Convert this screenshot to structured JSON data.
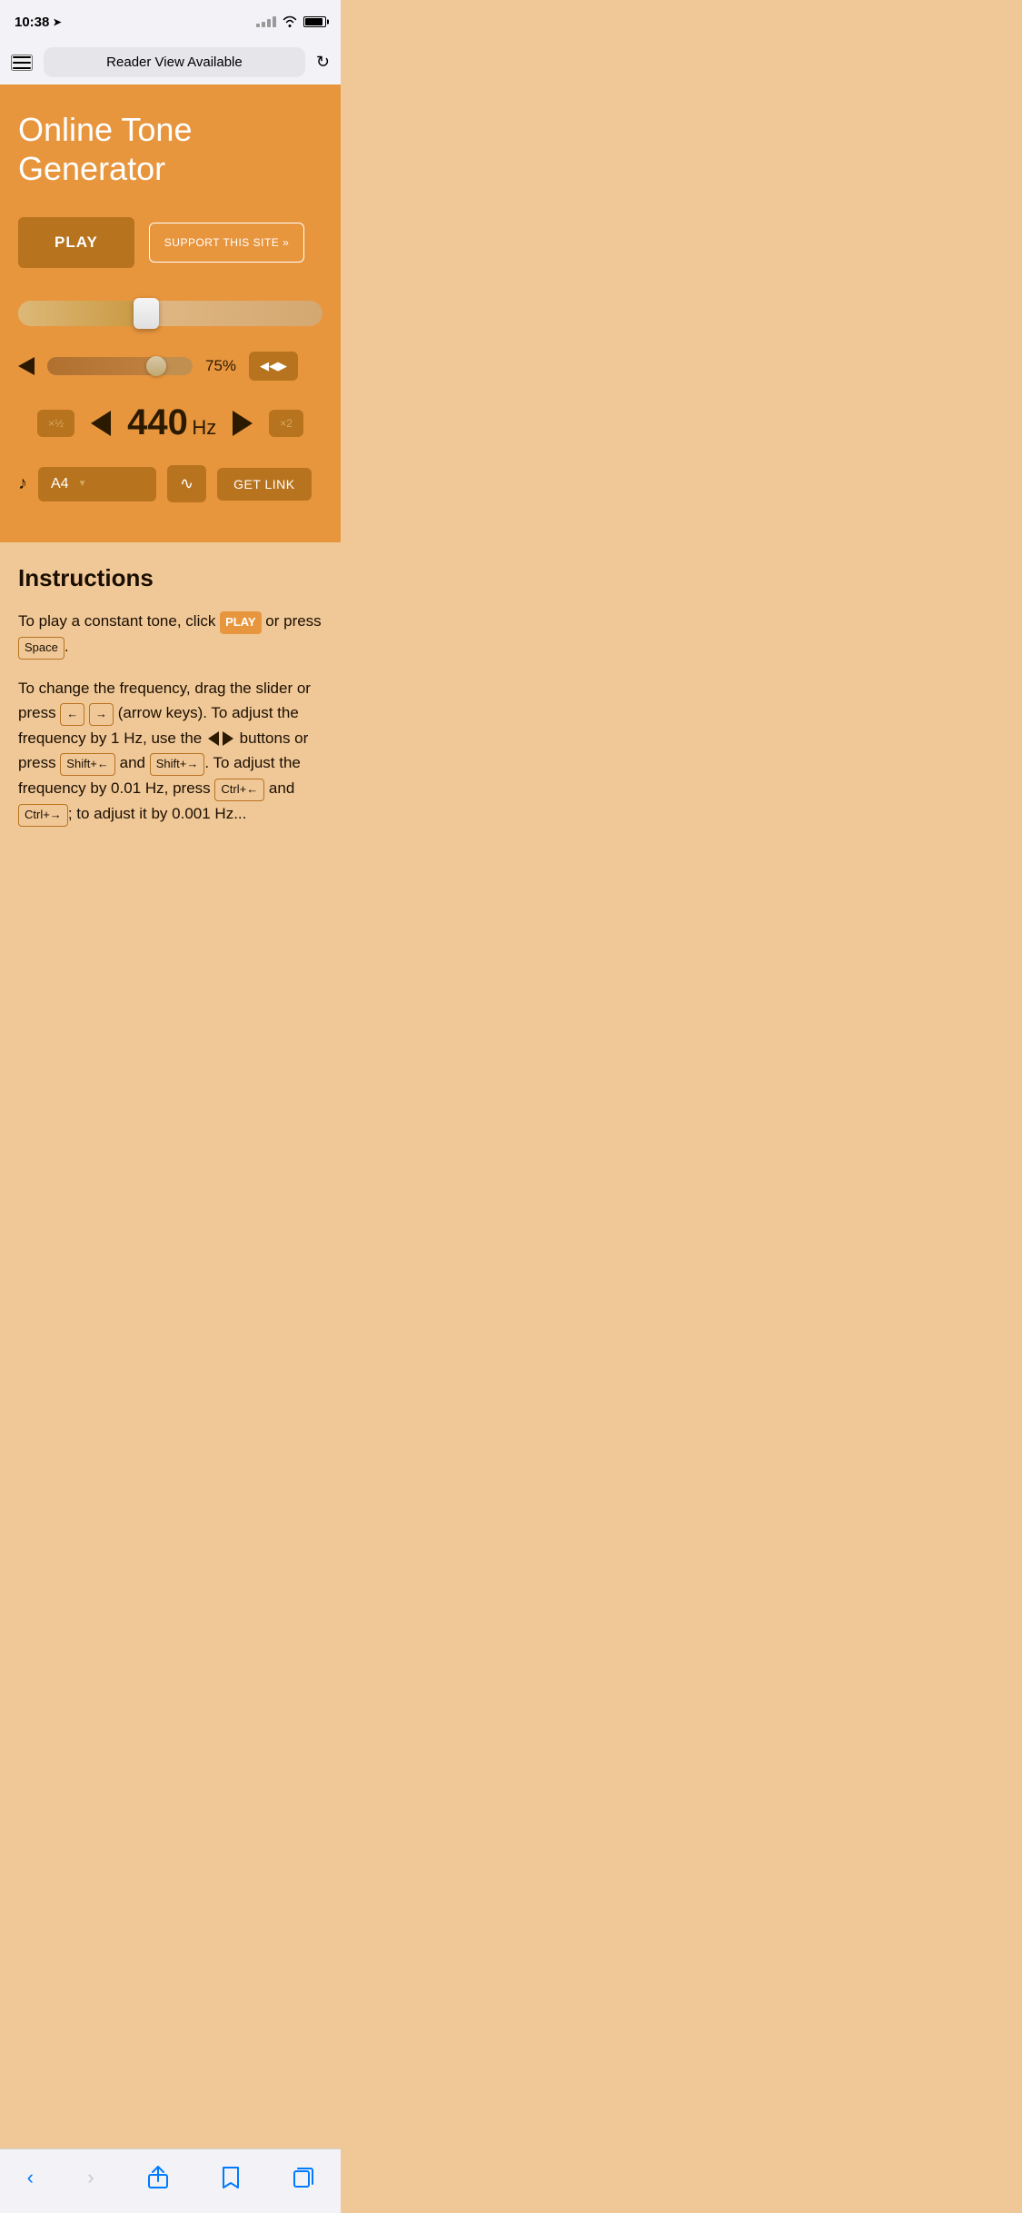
{
  "statusBar": {
    "time": "10:38",
    "locationArrow": "➤"
  },
  "browserBar": {
    "urlText": "Reader View Available"
  },
  "page": {
    "title": "Online Tone Generator",
    "playButton": "PLAY",
    "supportButton": "SUPPORT THIS SITE »",
    "frequencyValue": "440",
    "frequencyUnit": "Hz",
    "volumePercent": "75%",
    "noteValue": "A4",
    "multiplierHalf": "×½",
    "multiplierDouble": "×2",
    "getLinkButton": "GET LINK",
    "sliderPosition": 42
  },
  "instructions": {
    "title": "Instructions",
    "paragraph1a": "To play a constant tone, click ",
    "paragraph1play": "PLAY",
    "paragraph1b": " or press ",
    "paragraph1space": "Space",
    "paragraph1c": ".",
    "paragraph2a": "To change the frequency, drag the slider or press ",
    "paragraph2keys1": "←",
    "paragraph2keys2": "→",
    "paragraph2b": " (arrow keys). To adjust the frequency by 1 Hz, use the ",
    "paragraph2c": " buttons or press ",
    "paragraph2shift1": "Shift+←",
    "paragraph2d": " and ",
    "paragraph2shift2": "Shift+→",
    "paragraph2e": ". To adjust the frequency by 0.01 Hz, press ",
    "paragraph2ctrl1": "Ctrl+←",
    "paragraph2f": " and ",
    "paragraph2ctrl2": "Ctrl+→",
    "paragraph2g": "; to adjust it by 0.001 Hz..."
  },
  "bottomNav": {
    "back": "‹",
    "forward": "›",
    "share": "share",
    "bookmark": "bookmark",
    "tabs": "tabs"
  }
}
